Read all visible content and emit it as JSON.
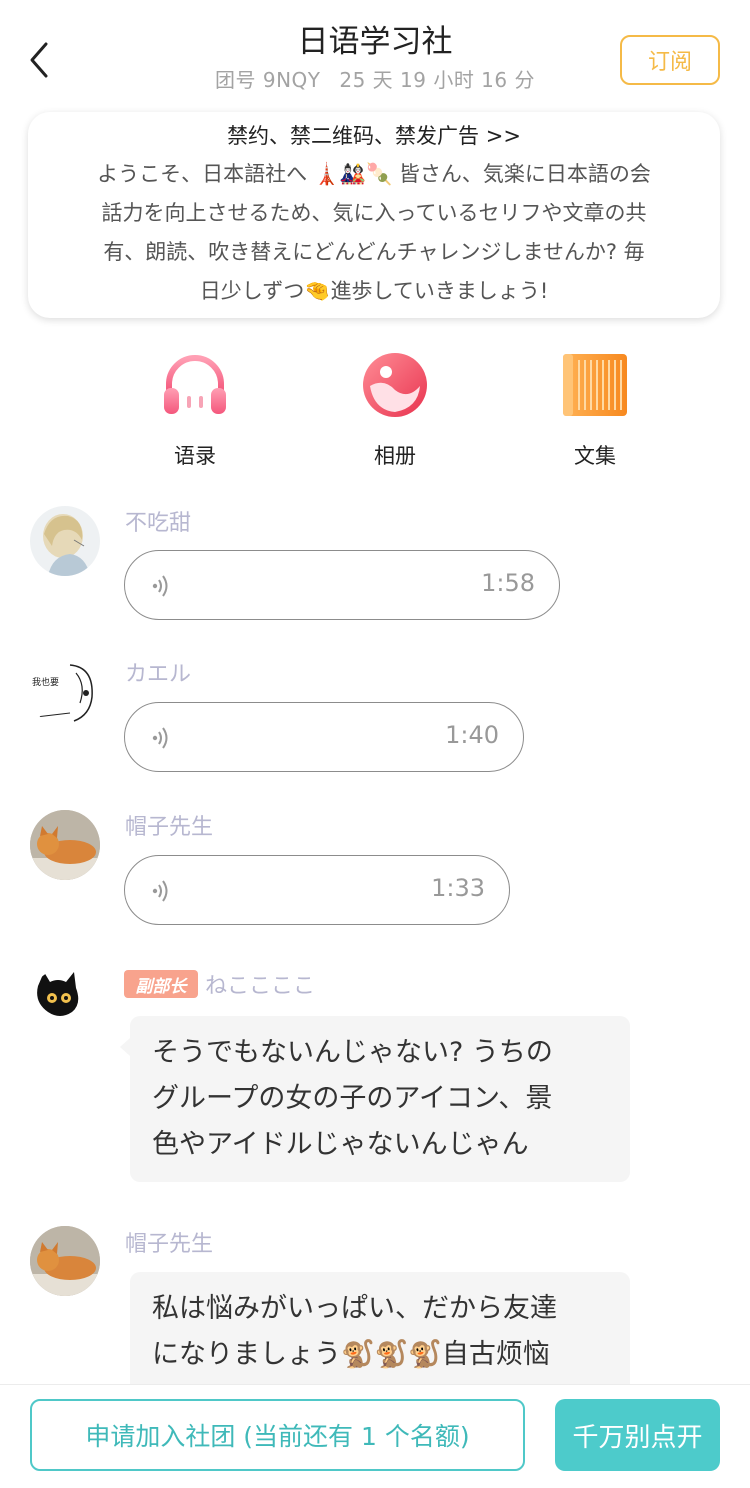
{
  "header": {
    "title": "日语学习社",
    "group_id": "团号 9NQY",
    "duration": "25 天 19 小时 16 分",
    "subscribe_label": "订阅"
  },
  "notice": {
    "title": "禁约、禁二维码、禁发广告 >>",
    "line1": "ようこそ、日本語社へ 🗼🎎🍡 皆さん、気楽に日本語の会",
    "line2": "話力を向上させるため、気に入っているセリフや文章の共",
    "line3": "有、朗読、吹き替えにどんどんチャレンジしませんか? 毎",
    "line4": "日少しずつ🤏進歩していきましょう!"
  },
  "features": [
    {
      "label": "语录",
      "icon": "headphones-icon"
    },
    {
      "label": "相册",
      "icon": "album-icon"
    },
    {
      "label": "文集",
      "icon": "book-collection-icon"
    }
  ],
  "messages": [
    {
      "sender": "不吃甜",
      "type": "voice",
      "duration": "1:58"
    },
    {
      "sender": "カエル",
      "type": "voice",
      "duration": "1:40",
      "avatar_text": "我也要"
    },
    {
      "sender": "帽子先生",
      "type": "voice",
      "duration": "1:33"
    },
    {
      "sender": "ねここここ",
      "badge": "副部长",
      "type": "text",
      "lines": [
        "そうでもないんじゃない? うちの",
        "グループの女の子のアイコン、景",
        "色やアイドルじゃないんじゃん"
      ]
    },
    {
      "sender": "帽子先生",
      "type": "text",
      "lines": [
        "私は悩みがいっぱい、だから友達",
        "になりましょう🐒🐒🐒自古烦恼"
      ]
    }
  ],
  "bottom": {
    "join_label": "申请加入社团 (当前还有 1 个名额)",
    "dont_click_label": "千万别点开"
  },
  "colors": {
    "accent_orange": "#f5ba47",
    "accent_teal": "#4dcbcb",
    "sender_name": "#b7b7d0",
    "badge": "#f8a38d"
  }
}
